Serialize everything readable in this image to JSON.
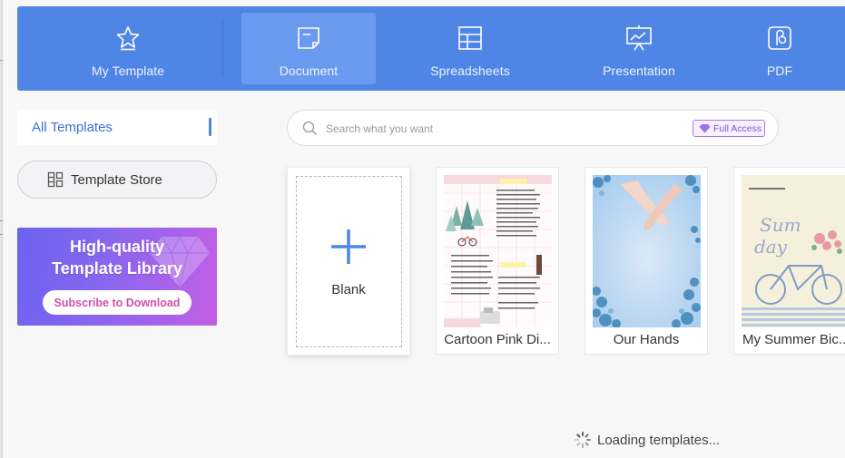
{
  "tabs": [
    {
      "label": "My Template",
      "icon": "star-icon",
      "active": false
    },
    {
      "label": "Document",
      "icon": "document-icon",
      "active": true
    },
    {
      "label": "Spreadsheets",
      "icon": "spreadsheet-icon",
      "active": false
    },
    {
      "label": "Presentation",
      "icon": "presentation-icon",
      "active": false
    },
    {
      "label": "PDF",
      "icon": "pdf-icon",
      "active": false
    }
  ],
  "sidebar": {
    "all_templates": "All Templates",
    "template_store": "Template Store"
  },
  "promo": {
    "line1": "High-quality",
    "line2": "Template Library",
    "button": "Subscribe to Download"
  },
  "search": {
    "placeholder": "Search what you want",
    "badge": "Full Access"
  },
  "cards": {
    "blank": "Blank",
    "items": [
      {
        "label": "Cartoon Pink Di..."
      },
      {
        "label": "Our Hands"
      },
      {
        "label": "My Summer Bic..."
      }
    ]
  },
  "loading": "Loading templates...",
  "colors": {
    "accent": "#4f86e6",
    "active_tab": "#6a9af0",
    "promo_start": "#6b63f2",
    "promo_end": "#c25fe6",
    "subscribe_text": "#d24fa8"
  }
}
